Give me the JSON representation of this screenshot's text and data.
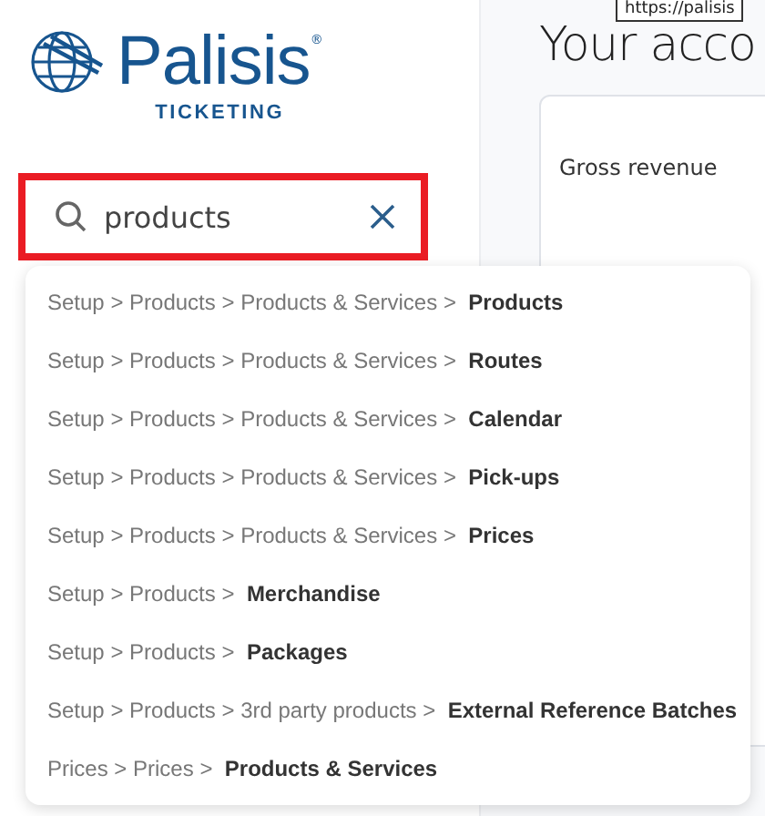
{
  "logo": {
    "name": "Palisis",
    "mark": "®",
    "tagline": "TICKETING"
  },
  "search": {
    "value": "products",
    "highlighted": true
  },
  "tooltip": {
    "text": "https://palisis"
  },
  "main": {
    "title": "Your acco",
    "card": {
      "label": "Gross revenue"
    }
  },
  "results": [
    {
      "text": "Setup > Products > Products & Services > **Products**"
    },
    {
      "text": "Setup > Products > Products & Services > **Routes**"
    },
    {
      "text": "Setup > Products > Products & Services > **Calendar**"
    },
    {
      "text": "Setup > Products > Products & Services > **Pick-ups**"
    },
    {
      "text": "Setup > Products > Products & Services > **Prices**"
    },
    {
      "text": "Setup > Products > **Merchandise**"
    },
    {
      "text": "Setup > Products > **Packages**"
    },
    {
      "text": "Setup > Products > 3rd party products > **External Reference Batches**"
    },
    {
      "text": "Prices > Prices > **Products & Services**"
    }
  ]
}
